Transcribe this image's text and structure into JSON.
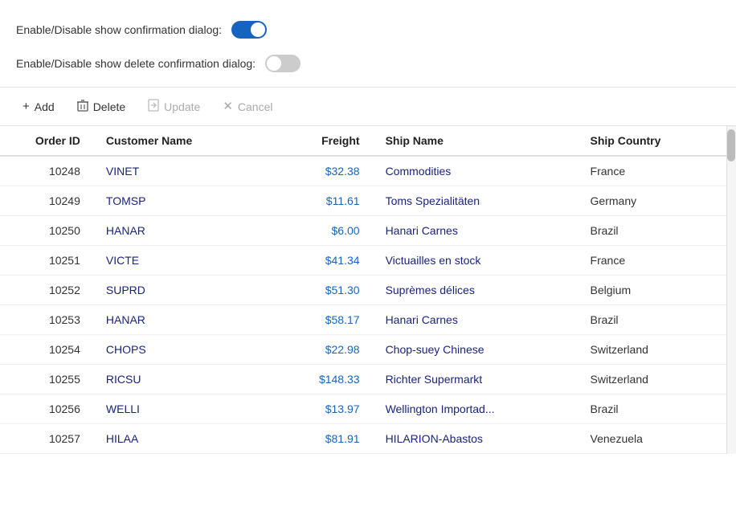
{
  "toggles": {
    "confirmation_label": "Enable/Disable show confirmation dialog:",
    "confirmation_state": "on",
    "delete_confirmation_label": "Enable/Disable show delete confirmation dialog:",
    "delete_confirmation_state": "off"
  },
  "toolbar": {
    "add_label": "Add",
    "delete_label": "Delete",
    "update_label": "Update",
    "cancel_label": "Cancel",
    "add_icon": "+",
    "delete_icon": "🗑",
    "update_icon": "⬇",
    "cancel_icon": "✕"
  },
  "grid": {
    "columns": [
      {
        "id": "orderid",
        "label": "Order ID"
      },
      {
        "id": "customer",
        "label": "Customer Name"
      },
      {
        "id": "freight",
        "label": "Freight"
      },
      {
        "id": "shipname",
        "label": "Ship Name"
      },
      {
        "id": "country",
        "label": "Ship Country"
      }
    ],
    "rows": [
      {
        "orderid": "10248",
        "customer": "VINET",
        "freight": "$32.38",
        "shipname": "Commodities",
        "country": "France"
      },
      {
        "orderid": "10249",
        "customer": "TOMSP",
        "freight": "$11.61",
        "shipname": "Toms Spezialitäten",
        "country": "Germany"
      },
      {
        "orderid": "10250",
        "customer": "HANAR",
        "freight": "$6.00",
        "shipname": "Hanari Carnes",
        "country": "Brazil"
      },
      {
        "orderid": "10251",
        "customer": "VICTE",
        "freight": "$41.34",
        "shipname": "Victuailles en stock",
        "country": "France"
      },
      {
        "orderid": "10252",
        "customer": "SUPRD",
        "freight": "$51.30",
        "shipname": "Suprèmes délices",
        "country": "Belgium"
      },
      {
        "orderid": "10253",
        "customer": "HANAR",
        "freight": "$58.17",
        "shipname": "Hanari Carnes",
        "country": "Brazil"
      },
      {
        "orderid": "10254",
        "customer": "CHOPS",
        "freight": "$22.98",
        "shipname": "Chop-suey Chinese",
        "country": "Switzerland"
      },
      {
        "orderid": "10255",
        "customer": "RICSU",
        "freight": "$148.33",
        "shipname": "Richter Supermarkt",
        "country": "Switzerland"
      },
      {
        "orderid": "10256",
        "customer": "WELLI",
        "freight": "$13.97",
        "shipname": "Wellington Importad...",
        "country": "Brazil"
      },
      {
        "orderid": "10257",
        "customer": "HILAA",
        "freight": "$81.91",
        "shipname": "HILARION-Abastos",
        "country": "Venezuela"
      }
    ]
  }
}
